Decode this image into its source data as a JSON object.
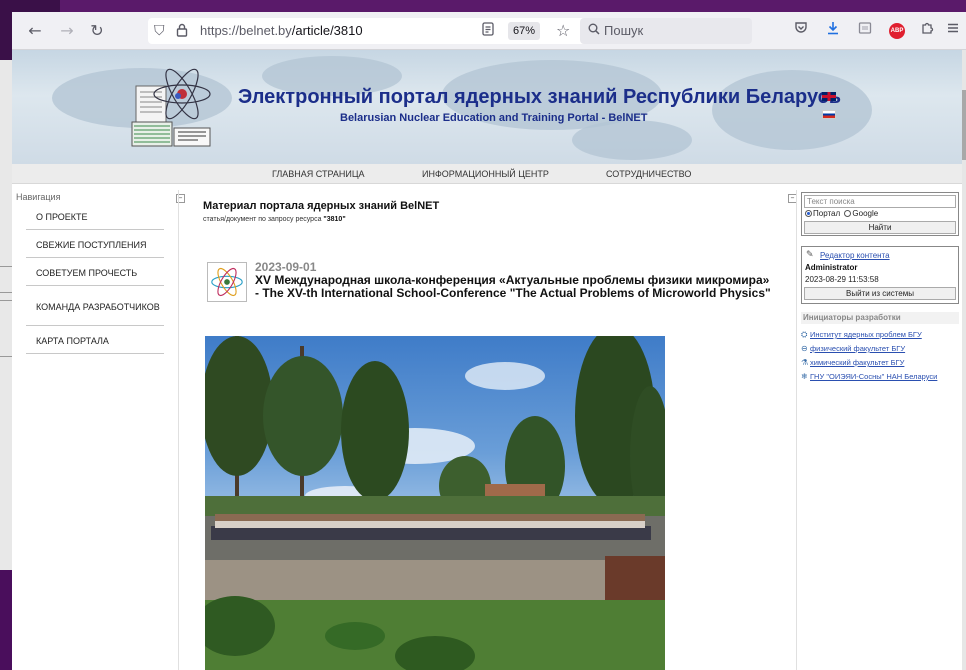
{
  "browser": {
    "url_host": "https://belnet.by",
    "url_path": "/article/3810",
    "zoom": "67%",
    "search_placeholder": "Пошук",
    "adblock_label": "ABP"
  },
  "banner": {
    "title": "Электронный портал ядерных знаний Республики Беларусь",
    "subtitle": "Belarusian Nuclear Education and Training Portal - BelNET"
  },
  "topmenu": [
    "ГЛАВНАЯ СТРАНИЦА",
    "ИНФОРМАЦИОННЫЙ ЦЕНТР",
    "СОТРУДНИЧЕСТВО"
  ],
  "leftnav": {
    "heading": "Навигация",
    "items": [
      "О ПРОЕКТЕ",
      "СВЕЖИЕ ПОСТУПЛЕНИЯ",
      "СОВЕТУЕМ ПРОЧЕСТЬ",
      "КОМАНДА РАЗРАБОТЧИКОВ",
      "КАРТА ПОРТАЛА"
    ]
  },
  "main": {
    "heading": "Материал портала ядерных знаний BelNET",
    "subtitle_prefix": "статья/документ по запросу ресурса ",
    "subtitle_id": "\"3810\"",
    "article_date": "2023-09-01",
    "article_title": "XV Международная школа-конференция «Актуальные проблемы физики микромира» - The XV-th International School-Conference \"The Actual Problems of Microworld Physics\""
  },
  "rightbar": {
    "search_placeholder": "Текст поиска",
    "radio_portal": "Портал",
    "radio_google": "Google",
    "find_button": "Найти",
    "editor_link": "Редактор контента",
    "editor_user": "Administrator",
    "editor_time": "2023-08-29 11:53:58",
    "logout_button": "Выйти из системы",
    "initiators_heading": "Инициаторы разработки",
    "initiators": [
      "Институт ядерных проблем БГУ",
      "физический факультет БГУ",
      "химический факультет БГУ",
      "ГНУ \"ОИЭЯИ-Сосны\" НАН Беларуси"
    ]
  },
  "colors": {
    "banner_title": "#1b2e8a",
    "link": "#2a4fb0",
    "desktop_bg": "#3a1048"
  }
}
